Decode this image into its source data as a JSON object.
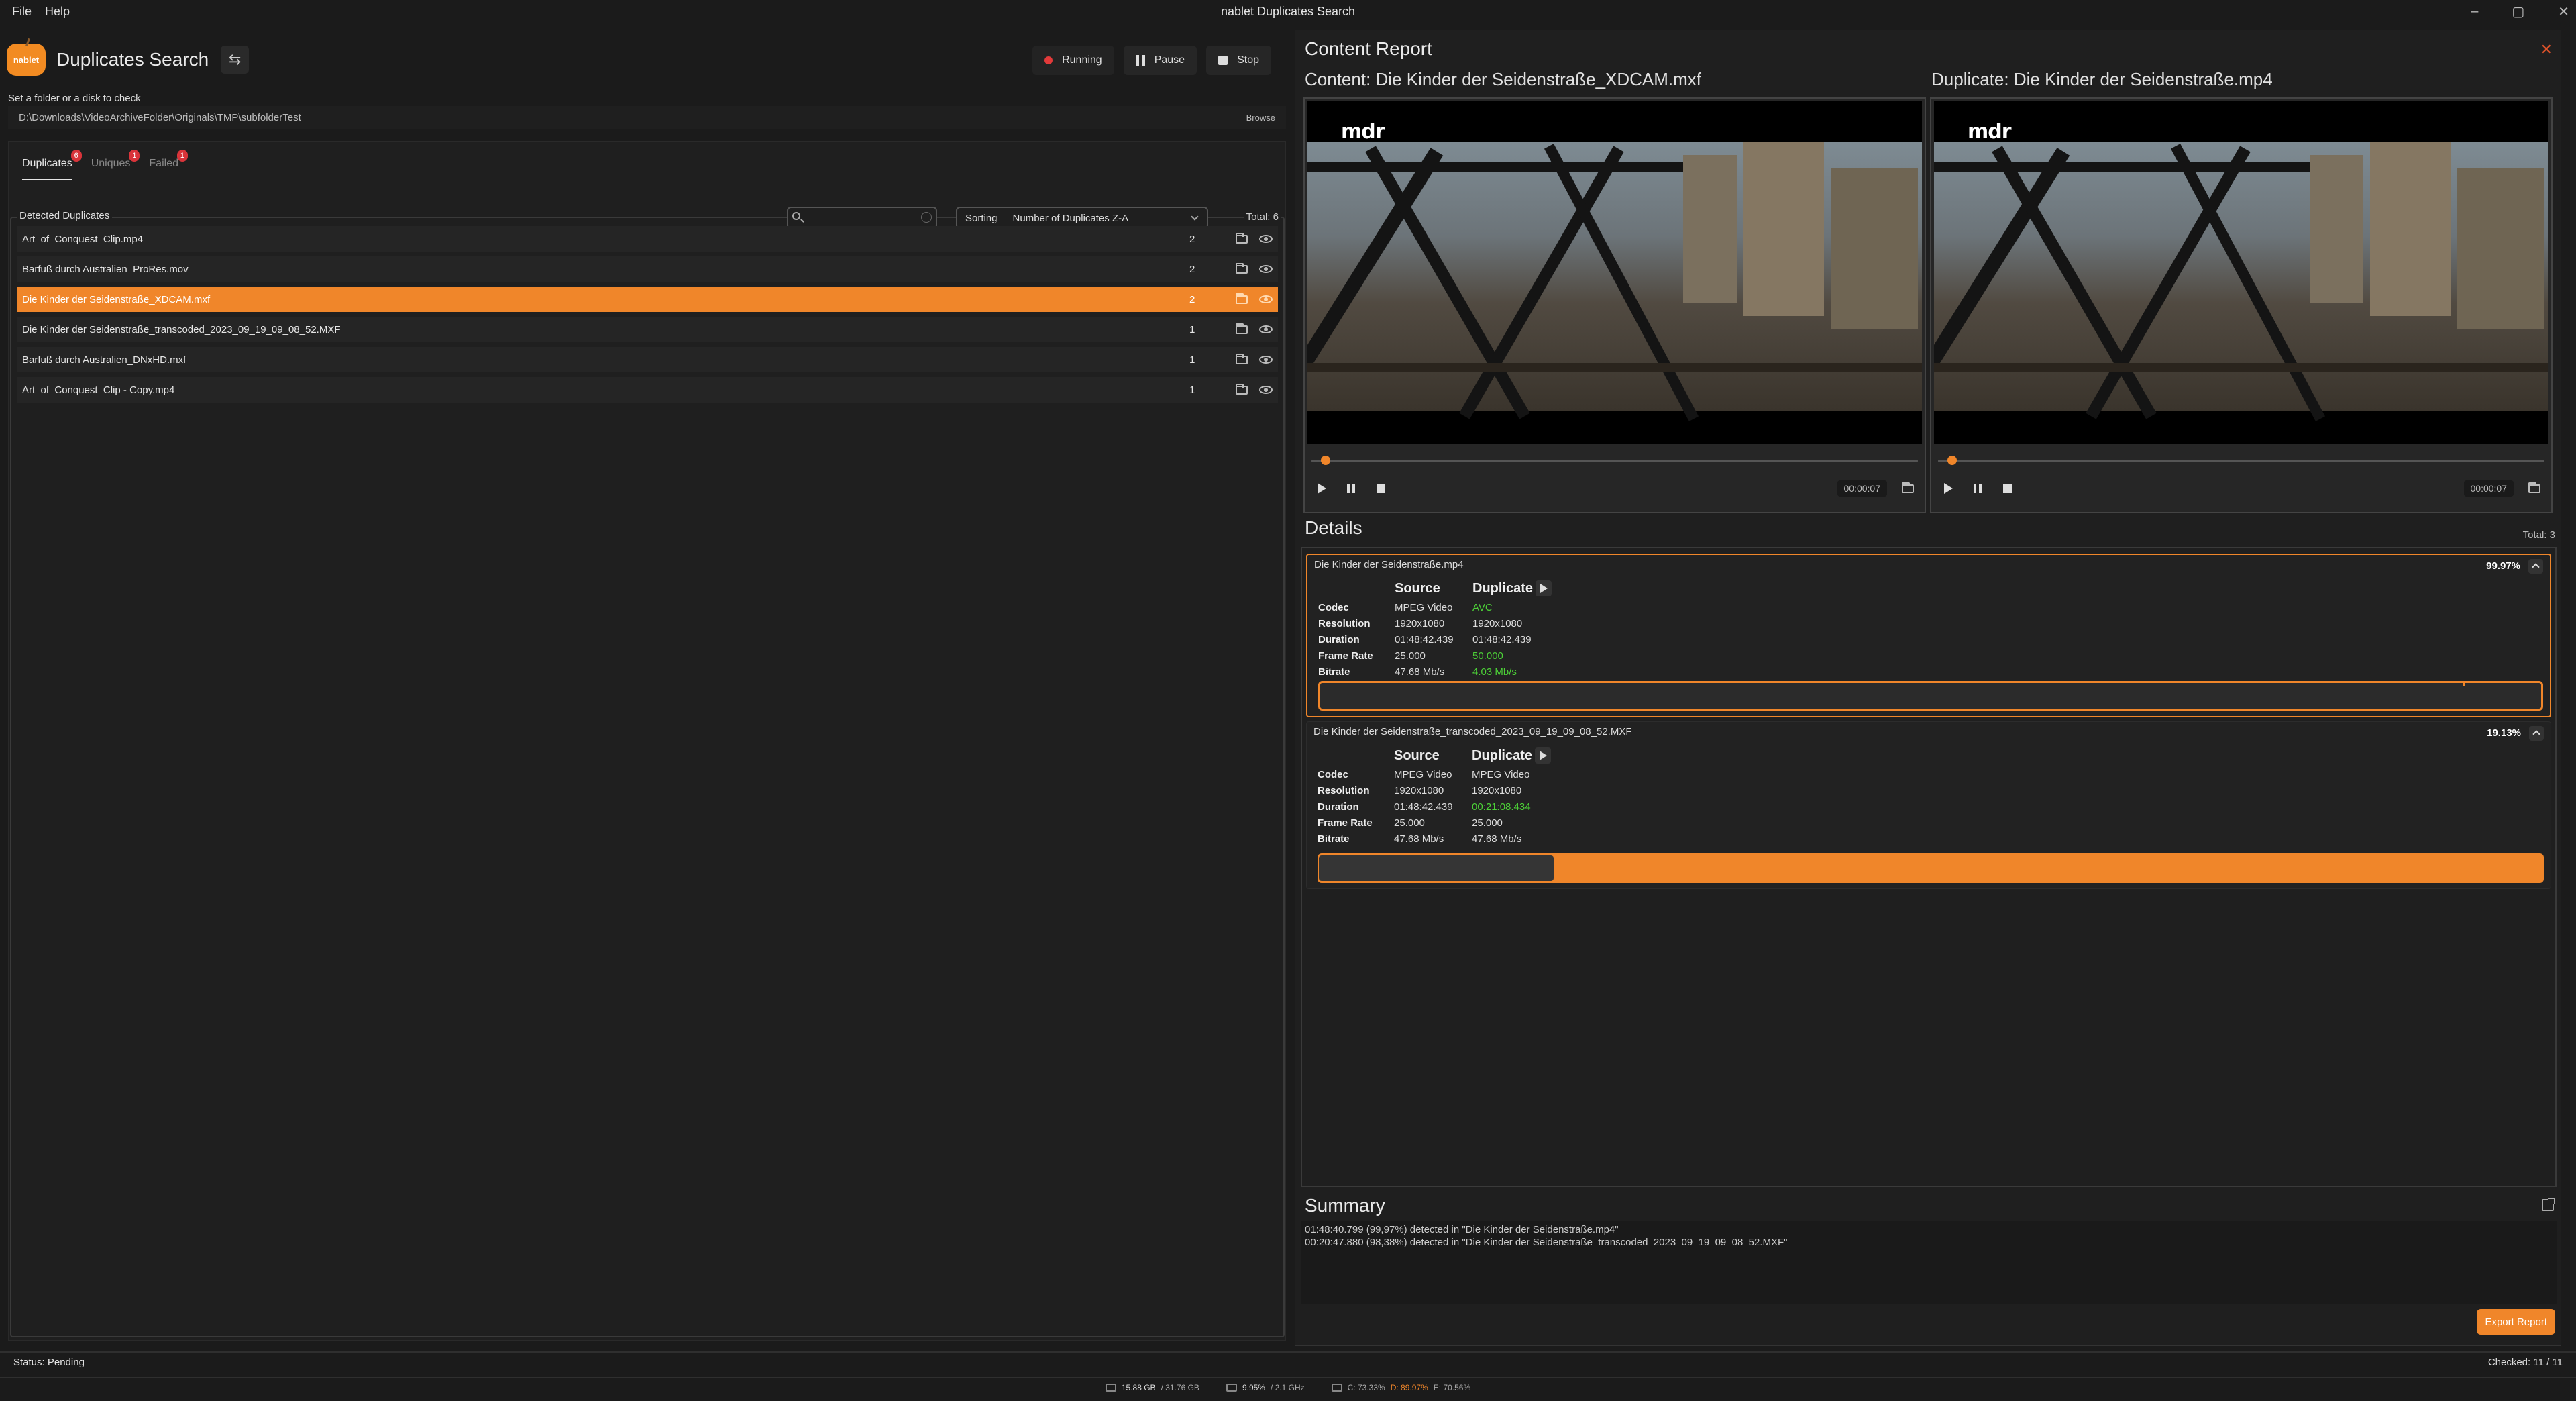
{
  "window": {
    "title": "nablet Duplicates Search",
    "menu": [
      "File",
      "Help"
    ]
  },
  "app": {
    "logo_text": "nablet",
    "title": "Duplicates Search",
    "running_label": "Running",
    "pause_label": "Pause",
    "stop_label": "Stop"
  },
  "source": {
    "label": "Set a folder or a disk to check",
    "path": "D:\\Downloads\\VideoArchiveFolder\\Originals\\TMP\\subfolderTest",
    "browse_label": "Browse"
  },
  "tabs": [
    {
      "label": "Duplicates",
      "badge": "6"
    },
    {
      "label": "Uniques",
      "badge": "1"
    },
    {
      "label": "Failed",
      "badge": "1"
    }
  ],
  "list": {
    "legend": "Detected Duplicates",
    "search_placeholder": "",
    "sorting_label": "Sorting",
    "sorting_value": "Number of Duplicates Z-A",
    "total": "Total: 6",
    "rows": [
      {
        "name": "Art_of_Conquest_Clip.mp4",
        "count": "2",
        "selected": false
      },
      {
        "name": "Barfuß durch Australien_ProRes.mov",
        "count": "2",
        "selected": false
      },
      {
        "name": "Die Kinder der Seidenstraße_XDCAM.mxf",
        "count": "2",
        "selected": true
      },
      {
        "name": "Die Kinder der Seidenstraße_transcoded_2023_09_19_09_08_52.MXF",
        "count": "1",
        "selected": false
      },
      {
        "name": "Barfuß durch Australien_DNxHD.mxf",
        "count": "1",
        "selected": false
      },
      {
        "name": "Art_of_Conquest_Clip - Copy.mp4",
        "count": "1",
        "selected": false
      }
    ]
  },
  "report": {
    "title": "Content Report",
    "content_label": "Content:  Die Kinder der Seidenstraße_XDCAM.mxf",
    "duplicate_label": "Duplicate:  Die Kinder der Seidenstraße.mp4",
    "player_watermark": "mdr",
    "content_time": "00:00:07",
    "duplicate_time": "00:00:07",
    "details_label": "Details",
    "details_total": "Total:  3",
    "cards": [
      {
        "name": "Die Kinder der Seidenstraße.mp4",
        "percent": "99.97%",
        "source_header": "Source",
        "duplicate_header": "Duplicate",
        "rows": [
          {
            "key": "Codec",
            "source": "MPEG Video",
            "dup": "AVC",
            "diff": true
          },
          {
            "key": "Resolution",
            "source": "1920x1080",
            "dup": "1920x1080",
            "diff": false
          },
          {
            "key": "Duration",
            "source": "01:48:42.439",
            "dup": "01:48:42.439",
            "diff": false
          },
          {
            "key": "Frame Rate",
            "source": "25.000",
            "dup": "50.000",
            "diff": true
          },
          {
            "key": "Bitrate",
            "source": "47.68 Mb/s",
            "dup": "4.03 Mb/s",
            "diff": true
          }
        ]
      },
      {
        "name": "Die Kinder der Seidenstraße_transcoded_2023_09_19_09_08_52.MXF",
        "percent": "19.13%",
        "source_header": "Source",
        "duplicate_header": "Duplicate",
        "rows": [
          {
            "key": "Codec",
            "source": "MPEG Video",
            "dup": "MPEG Video",
            "diff": false
          },
          {
            "key": "Resolution",
            "source": "1920x1080",
            "dup": "1920x1080",
            "diff": false
          },
          {
            "key": "Duration",
            "source": "01:48:42.439",
            "dup": "00:21:08.434",
            "diff": true
          },
          {
            "key": "Frame Rate",
            "source": "25.000",
            "dup": "25.000",
            "diff": false
          },
          {
            "key": "Bitrate",
            "source": "47.68 Mb/s",
            "dup": "47.68 Mb/s",
            "diff": false
          }
        ]
      }
    ],
    "summary_label": "Summary",
    "summary_lines": [
      "01:48:40.799 (99,97%) detected in \"Die Kinder der Seidenstraße.mp4\"",
      "00:20:47.880 (98,38%) detected in \"Die Kinder der Seidenstraße_transcoded_2023_09_19_09_08_52.MXF\""
    ],
    "export_label": "Export Report"
  },
  "status": {
    "text": "Status:  Pending",
    "checked": "Checked:  11 / 11"
  },
  "sysbar": {
    "mem_used": "15.88 GB",
    "mem_total": "/ 31.76 GB",
    "cpu_pct": "9.95%",
    "cpu_freq": "/ 2.1 GHz",
    "disk_c": "C: 73.33%",
    "disk_d": "D: 89.97%",
    "disk_e": "E: 70.56%"
  },
  "colors": {
    "accent": "#f0862a",
    "diff_green": "#4cd137",
    "badge_red": "#d9343a"
  }
}
